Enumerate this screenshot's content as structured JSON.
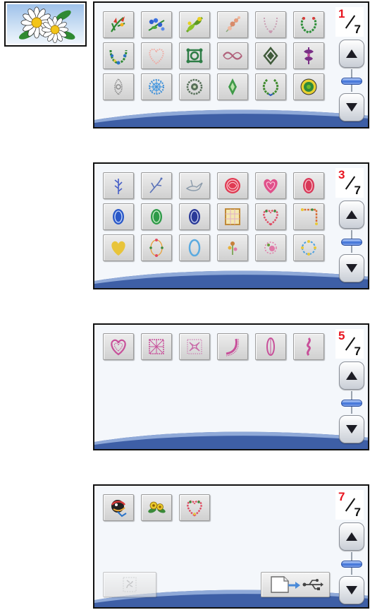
{
  "category": {
    "icon": "sunflower-bouquet-icon"
  },
  "panels": [
    {
      "page": {
        "current": "1",
        "total": "7"
      },
      "patterns": [
        {
          "icon": "bird-of-paradise-flower-icon",
          "color": "#d63a2a"
        },
        {
          "icon": "blue-forget-me-not-icon",
          "color": "#2e5fd0"
        },
        {
          "icon": "yellow-green-flower-icon",
          "color": "#8cc22a"
        },
        {
          "icon": "pink-floral-spray-icon",
          "color": "#d88a6a"
        },
        {
          "icon": "pink-blossom-arc-icon",
          "color": "#c89ab0"
        },
        {
          "icon": "green-wreath-arc-icon",
          "color": "#2f8f3a"
        },
        {
          "icon": "blue-green-wreath-icon",
          "color": "#2b73c5"
        },
        {
          "icon": "pink-lace-heart-icon",
          "color": "#f0a8a0"
        },
        {
          "icon": "green-celtic-knot-icon",
          "color": "#2e7d46"
        },
        {
          "icon": "mauve-border-scroll-icon",
          "color": "#b0607a"
        },
        {
          "icon": "dark-green-ornament-icon",
          "color": "#3f5a3a"
        },
        {
          "icon": "purple-ornament-icon",
          "color": "#7a2f86"
        },
        {
          "icon": "grey-lace-ornament-icon",
          "color": "#8a8a8a"
        },
        {
          "icon": "blue-snowflake-doily-icon",
          "color": "#3d8fd8"
        },
        {
          "icon": "grey-green-doily-icon",
          "color": "#58705a"
        },
        {
          "icon": "green-diamond-ornament-icon",
          "color": "#3f9a48"
        },
        {
          "icon": "green-laurel-wreath-icon",
          "color": "#3e8a2c"
        },
        {
          "icon": "yellow-green-round-frame-icon",
          "color": "#6ab82a"
        }
      ]
    },
    {
      "page": {
        "current": "3",
        "total": "7"
      },
      "patterns": [
        {
          "icon": "blue-branch-icon",
          "color": "#4860c8"
        },
        {
          "icon": "blue-sprig-icon",
          "color": "#5870b8"
        },
        {
          "icon": "grey-bird-icon",
          "color": "#8a9aaa"
        },
        {
          "icon": "red-round-celtic-icon",
          "color": "#e03a52"
        },
        {
          "icon": "pink-heart-celtic-icon",
          "color": "#e0508a"
        },
        {
          "icon": "red-oval-celtic-icon",
          "color": "#d83858"
        },
        {
          "icon": "blue-oval-celtic-icon",
          "color": "#2a58c8"
        },
        {
          "icon": "green-oval-celtic-icon",
          "color": "#2e9a48"
        },
        {
          "icon": "navy-oval-celtic-icon",
          "color": "#2a3a98"
        },
        {
          "icon": "lattice-square-frame-icon",
          "color": "#c08a3a"
        },
        {
          "icon": "flower-heart-wreath-icon",
          "color": "#e04a62"
        },
        {
          "icon": "flower-corner-border-icon",
          "color": "#d8703a"
        },
        {
          "icon": "yellow-lace-heart-icon",
          "color": "#e8c43a"
        },
        {
          "icon": "flower-oval-frame-icon",
          "color": "#e8a03a"
        },
        {
          "icon": "blue-oval-frame-icon",
          "color": "#5aaae0"
        },
        {
          "icon": "small-flower-sprig-icon",
          "color": "#c8803a"
        },
        {
          "icon": "rose-ring-icon",
          "color": "#e07aa8"
        },
        {
          "icon": "blue-flower-ring-icon",
          "color": "#4aa0e0"
        }
      ]
    },
    {
      "page": {
        "current": "5",
        "total": "7"
      },
      "patterns": [
        {
          "icon": "pink-quilt-heart-icon",
          "color": "#c8509a"
        },
        {
          "icon": "pink-quilt-block-icon",
          "color": "#c8509a"
        },
        {
          "icon": "pink-quilt-knot-square-icon",
          "color": "#c86aa8"
        },
        {
          "icon": "pink-quilt-corner-icon",
          "color": "#c8509a"
        },
        {
          "icon": "pink-quilt-oval-icon",
          "color": "#c8509a"
        },
        {
          "icon": "pink-quilt-vine-icon",
          "color": "#c8509a"
        }
      ]
    },
    {
      "page": {
        "current": "7",
        "total": "7"
      },
      "patterns": [
        {
          "icon": "peacock-parrot-icon",
          "color": "#b02a2a"
        },
        {
          "icon": "yellow-flower-bouquet-icon",
          "color": "#e8c82a"
        },
        {
          "icon": "flower-heart-wreath-icon",
          "color": "#e04a62"
        }
      ],
      "memory_button_icon": "saved-pattern-icon",
      "usb_button_icon": "file-to-usb-icon"
    }
  ]
}
